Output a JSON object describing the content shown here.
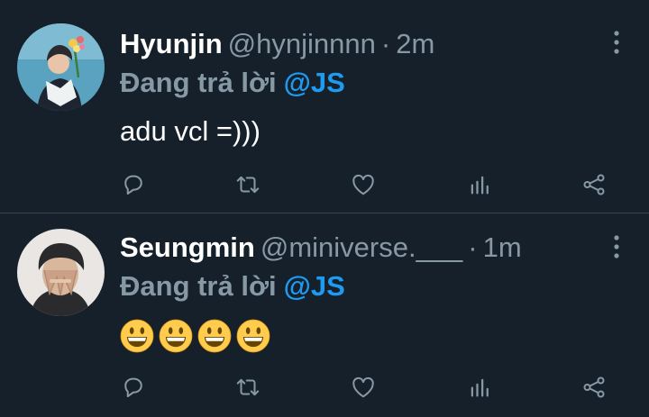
{
  "colors": {
    "background": "#15202b",
    "divider": "#38444d",
    "secondary_text": "#8899a6",
    "accent": "#1d9bf0",
    "icon": "#8899a6"
  },
  "tweets": [
    {
      "name": "Hyunjin",
      "handle": "@hynjinnnn",
      "separator": "·",
      "time": "2m",
      "reply_prefix": "Đang trả lời",
      "reply_to": "@JS",
      "text": "adu vcl =)))",
      "more_icon": "more-vertical-icon",
      "actions": [
        "reply-icon",
        "retweet-icon",
        "like-icon",
        "analytics-icon",
        "share-icon"
      ]
    },
    {
      "name": "Seungmin",
      "handle": "@miniverse.___",
      "separator": "·",
      "time": "1m",
      "reply_prefix": "Đang trả lời",
      "reply_to": "@JS",
      "text_emojis": [
        "grinning-face-emoji",
        "grinning-face-emoji",
        "grinning-face-emoji",
        "grinning-face-emoji"
      ],
      "more_icon": "more-vertical-icon",
      "actions": [
        "reply-icon",
        "retweet-icon",
        "like-icon",
        "analytics-icon",
        "share-icon"
      ]
    }
  ]
}
